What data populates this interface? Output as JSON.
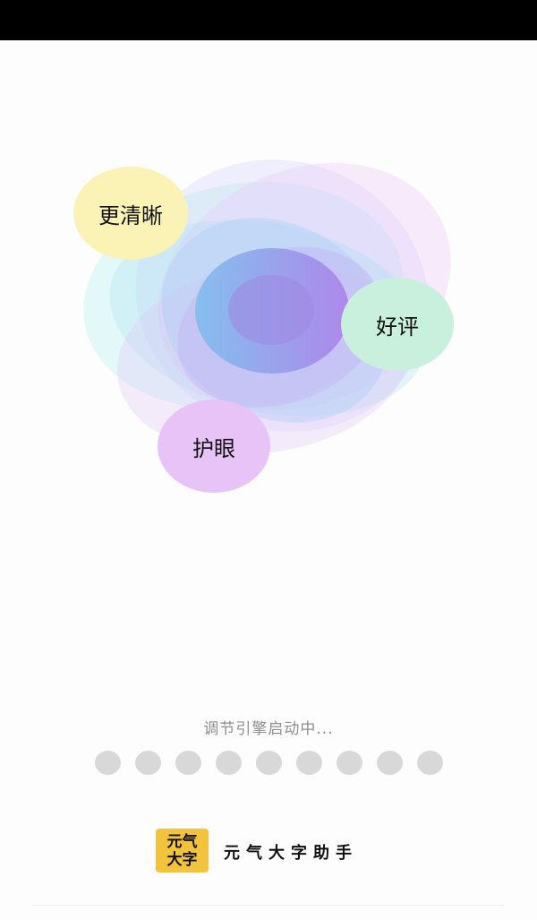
{
  "bubbles": {
    "clearer": "更清晰",
    "review": "好评",
    "eye_care": "护眼"
  },
  "loading": {
    "text": "调节引擎启动中...",
    "dot_count": 9,
    "dot_color": "#d8d8d8"
  },
  "brand": {
    "logo_line1": "元气",
    "logo_line2": "大字",
    "logo_color": "#f2c33d",
    "app_name": "元气大字助手"
  }
}
